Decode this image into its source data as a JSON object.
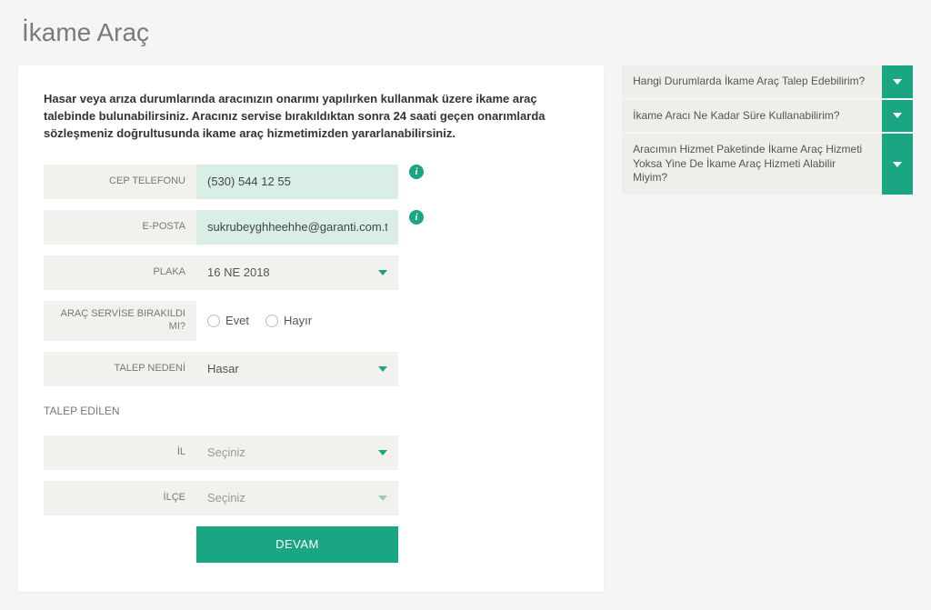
{
  "page": {
    "title": "İkame Araç",
    "intro": "Hasar veya arıza durumlarında aracınızın onarımı yapılırken kullanmak üzere ikame araç talebinde bulunabilirsiniz. Aracınız servise bırakıldıktan sonra 24 saati geçen onarımlarda sözleşmeniz doğrultusunda ikame araç hizmetimizden yararlanabilirsiniz."
  },
  "form": {
    "phone": {
      "label": "CEP TELEFONU",
      "value": "(530) 544 12 55"
    },
    "email": {
      "label": "E-POSTA",
      "value": "sukrubeyghheehhe@garanti.com.tr"
    },
    "plate": {
      "label": "PLAKA",
      "value": "16 NE 2018"
    },
    "service_dropped": {
      "label": "ARAÇ SERVİSE BIRAKILDI MI?",
      "options": {
        "yes": "Evet",
        "no": "Hayır"
      }
    },
    "reason": {
      "label": "TALEP NEDENİ",
      "value": "Hasar"
    },
    "requested_section": "TALEP EDİLEN",
    "province": {
      "label": "İL",
      "placeholder": "Seçiniz"
    },
    "district": {
      "label": "İLÇE",
      "placeholder": "Seçiniz"
    },
    "submit": "DEVAM"
  },
  "faq": [
    {
      "q": "Hangi Durumlarda İkame Araç Talep Edebilirim?"
    },
    {
      "q": "İkame Aracı Ne Kadar Süre Kullanabilirim?"
    },
    {
      "q": "Aracımın Hizmet Paketinde İkame Araç Hizmeti Yoksa Yine De İkame Araç Hizmeti Alabilir Miyim?"
    }
  ],
  "icons": {
    "info": "i"
  }
}
